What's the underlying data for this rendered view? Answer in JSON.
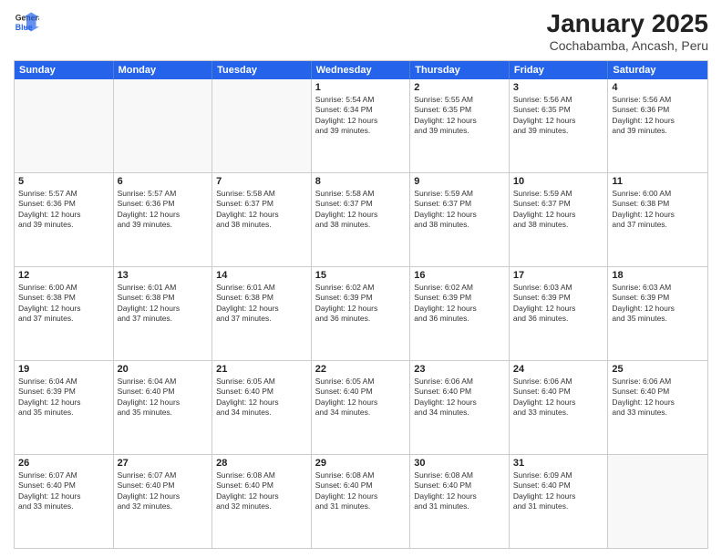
{
  "header": {
    "logo_general": "General",
    "logo_blue": "Blue",
    "month_title": "January 2025",
    "location": "Cochabamba, Ancash, Peru"
  },
  "weekdays": [
    "Sunday",
    "Monday",
    "Tuesday",
    "Wednesday",
    "Thursday",
    "Friday",
    "Saturday"
  ],
  "rows": [
    [
      {
        "day": "",
        "text": ""
      },
      {
        "day": "",
        "text": ""
      },
      {
        "day": "",
        "text": ""
      },
      {
        "day": "1",
        "text": "Sunrise: 5:54 AM\nSunset: 6:34 PM\nDaylight: 12 hours\nand 39 minutes."
      },
      {
        "day": "2",
        "text": "Sunrise: 5:55 AM\nSunset: 6:35 PM\nDaylight: 12 hours\nand 39 minutes."
      },
      {
        "day": "3",
        "text": "Sunrise: 5:56 AM\nSunset: 6:35 PM\nDaylight: 12 hours\nand 39 minutes."
      },
      {
        "day": "4",
        "text": "Sunrise: 5:56 AM\nSunset: 6:36 PM\nDaylight: 12 hours\nand 39 minutes."
      }
    ],
    [
      {
        "day": "5",
        "text": "Sunrise: 5:57 AM\nSunset: 6:36 PM\nDaylight: 12 hours\nand 39 minutes."
      },
      {
        "day": "6",
        "text": "Sunrise: 5:57 AM\nSunset: 6:36 PM\nDaylight: 12 hours\nand 39 minutes."
      },
      {
        "day": "7",
        "text": "Sunrise: 5:58 AM\nSunset: 6:37 PM\nDaylight: 12 hours\nand 38 minutes."
      },
      {
        "day": "8",
        "text": "Sunrise: 5:58 AM\nSunset: 6:37 PM\nDaylight: 12 hours\nand 38 minutes."
      },
      {
        "day": "9",
        "text": "Sunrise: 5:59 AM\nSunset: 6:37 PM\nDaylight: 12 hours\nand 38 minutes."
      },
      {
        "day": "10",
        "text": "Sunrise: 5:59 AM\nSunset: 6:37 PM\nDaylight: 12 hours\nand 38 minutes."
      },
      {
        "day": "11",
        "text": "Sunrise: 6:00 AM\nSunset: 6:38 PM\nDaylight: 12 hours\nand 37 minutes."
      }
    ],
    [
      {
        "day": "12",
        "text": "Sunrise: 6:00 AM\nSunset: 6:38 PM\nDaylight: 12 hours\nand 37 minutes."
      },
      {
        "day": "13",
        "text": "Sunrise: 6:01 AM\nSunset: 6:38 PM\nDaylight: 12 hours\nand 37 minutes."
      },
      {
        "day": "14",
        "text": "Sunrise: 6:01 AM\nSunset: 6:38 PM\nDaylight: 12 hours\nand 37 minutes."
      },
      {
        "day": "15",
        "text": "Sunrise: 6:02 AM\nSunset: 6:39 PM\nDaylight: 12 hours\nand 36 minutes."
      },
      {
        "day": "16",
        "text": "Sunrise: 6:02 AM\nSunset: 6:39 PM\nDaylight: 12 hours\nand 36 minutes."
      },
      {
        "day": "17",
        "text": "Sunrise: 6:03 AM\nSunset: 6:39 PM\nDaylight: 12 hours\nand 36 minutes."
      },
      {
        "day": "18",
        "text": "Sunrise: 6:03 AM\nSunset: 6:39 PM\nDaylight: 12 hours\nand 35 minutes."
      }
    ],
    [
      {
        "day": "19",
        "text": "Sunrise: 6:04 AM\nSunset: 6:39 PM\nDaylight: 12 hours\nand 35 minutes."
      },
      {
        "day": "20",
        "text": "Sunrise: 6:04 AM\nSunset: 6:40 PM\nDaylight: 12 hours\nand 35 minutes."
      },
      {
        "day": "21",
        "text": "Sunrise: 6:05 AM\nSunset: 6:40 PM\nDaylight: 12 hours\nand 34 minutes."
      },
      {
        "day": "22",
        "text": "Sunrise: 6:05 AM\nSunset: 6:40 PM\nDaylight: 12 hours\nand 34 minutes."
      },
      {
        "day": "23",
        "text": "Sunrise: 6:06 AM\nSunset: 6:40 PM\nDaylight: 12 hours\nand 34 minutes."
      },
      {
        "day": "24",
        "text": "Sunrise: 6:06 AM\nSunset: 6:40 PM\nDaylight: 12 hours\nand 33 minutes."
      },
      {
        "day": "25",
        "text": "Sunrise: 6:06 AM\nSunset: 6:40 PM\nDaylight: 12 hours\nand 33 minutes."
      }
    ],
    [
      {
        "day": "26",
        "text": "Sunrise: 6:07 AM\nSunset: 6:40 PM\nDaylight: 12 hours\nand 33 minutes."
      },
      {
        "day": "27",
        "text": "Sunrise: 6:07 AM\nSunset: 6:40 PM\nDaylight: 12 hours\nand 32 minutes."
      },
      {
        "day": "28",
        "text": "Sunrise: 6:08 AM\nSunset: 6:40 PM\nDaylight: 12 hours\nand 32 minutes."
      },
      {
        "day": "29",
        "text": "Sunrise: 6:08 AM\nSunset: 6:40 PM\nDaylight: 12 hours\nand 31 minutes."
      },
      {
        "day": "30",
        "text": "Sunrise: 6:08 AM\nSunset: 6:40 PM\nDaylight: 12 hours\nand 31 minutes."
      },
      {
        "day": "31",
        "text": "Sunrise: 6:09 AM\nSunset: 6:40 PM\nDaylight: 12 hours\nand 31 minutes."
      },
      {
        "day": "",
        "text": ""
      }
    ]
  ]
}
